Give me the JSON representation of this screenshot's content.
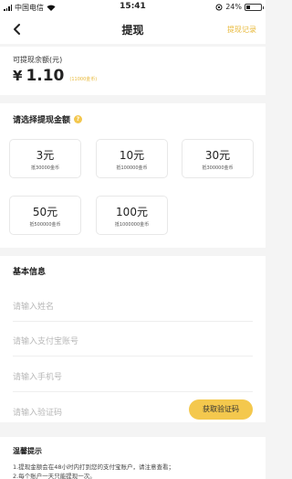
{
  "status_bar": {
    "carrier": "中国电信",
    "time": "15:41",
    "battery": "24%",
    "battery_level": 0.24
  },
  "nav": {
    "title": "提现",
    "record": "提现记录"
  },
  "balance": {
    "label": "可提现余额(元)",
    "currency": "¥",
    "amount": "1.10",
    "coins": "(11000金币)"
  },
  "amounts": {
    "title": "请选择提现金额",
    "options": [
      {
        "yuan": "3元",
        "coins": "抵30000金币"
      },
      {
        "yuan": "10元",
        "coins": "抵100000金币"
      },
      {
        "yuan": "30元",
        "coins": "抵300000金币"
      },
      {
        "yuan": "50元",
        "coins": "抵500000金币"
      },
      {
        "yuan": "100元",
        "coins": "抵1000000金币"
      }
    ]
  },
  "info": {
    "title": "基本信息",
    "name_placeholder": "请输入姓名",
    "alipay_placeholder": "请输入支付宝账号",
    "phone_placeholder": "请输入手机号",
    "code_placeholder": "请输入验证码",
    "code_button": "获取验证码"
  },
  "tips": {
    "title": "温馨提示",
    "lines": [
      "1.提现金额会在48小时内打到您的支付宝账户，请注意查看；",
      "2.每个账户一天只能提现一次。"
    ]
  }
}
